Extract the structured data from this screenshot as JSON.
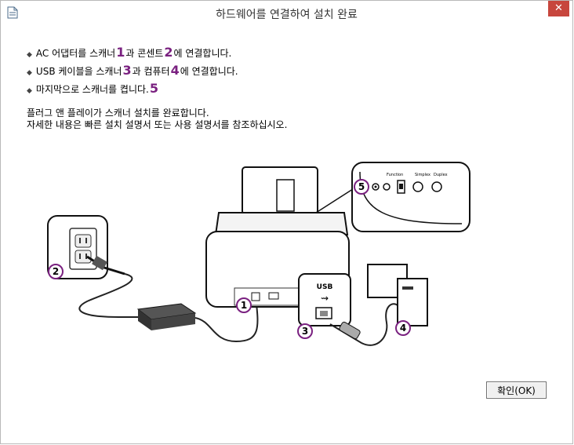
{
  "window": {
    "title": "하드웨어를 연결하여 설치 완료",
    "close_label": "✕"
  },
  "steps": [
    {
      "parts": [
        "AC 어댑터를 스캐너 ",
        "1",
        "과 콘센트 ",
        "2",
        "에 연결합니다."
      ]
    },
    {
      "parts": [
        "USB 케이블을 스캐너 ",
        "3",
        "과 컴퓨터 ",
        "4",
        "에 연결합니다."
      ]
    },
    {
      "parts": [
        "마지막으로 스캐너를 켭니다.",
        "5"
      ]
    }
  ],
  "note": {
    "line1": "플러그 앤 플레이가 스캐너 설치를 완료합니다.",
    "line2": "자세한 내용은 빠른 설치 설명서 또는 사용 설명서를 참조하십시오."
  },
  "diagram": {
    "callouts": [
      "1",
      "2",
      "3",
      "4",
      "5"
    ],
    "usb_label": "USB",
    "panel_labels": {
      "function": "Function",
      "simplex": "Simplex",
      "duplex": "Duplex"
    }
  },
  "buttons": {
    "ok": "확인(OK)"
  },
  "colors": {
    "accent": "#7a2180",
    "close": "#c7463d"
  }
}
